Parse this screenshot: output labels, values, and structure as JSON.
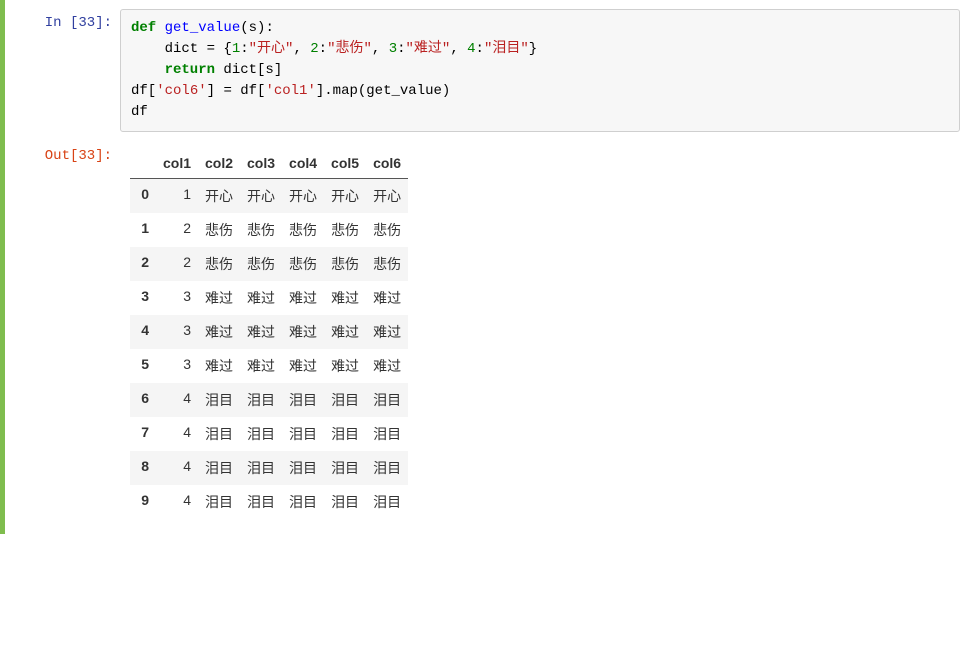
{
  "input": {
    "prompt": "In [33]:",
    "code_line1_def": "def",
    "code_line1_fn": " get_value",
    "code_line1_paren_open": "(",
    "code_line1_arg": "s",
    "code_line1_paren_close": ")",
    "code_line1_colon": ":",
    "code_line2_tail": "}",
    "code": {
      "dict_assign": "    dict = {",
      "k1": "1",
      "c1": ":",
      "v1": "\"开心\"",
      "sep1": ", ",
      "k2": "2",
      "c2": ":",
      "v2": "\"悲伤\"",
      "sep2": ", ",
      "k3": "3",
      "c3": ":",
      "v3": "\"难过\"",
      "sep3": ", ",
      "k4": "4",
      "c4": ":",
      "v4": "\"泪目\""
    },
    "code_line3_return": "    return",
    "code_line3_tail": " dict[s]",
    "code_line4_pre": "df[",
    "code_line4_col6": "'col6'",
    "code_line4_mid": "] = df[",
    "code_line4_col1": "'col1'",
    "code_line4_tail": "].map(get_value)",
    "code_line5": "df"
  },
  "output": {
    "prompt": "Out[33]:"
  },
  "chart_data": {
    "type": "table",
    "columns": [
      "col1",
      "col2",
      "col3",
      "col4",
      "col5",
      "col6"
    ],
    "index": [
      "0",
      "1",
      "2",
      "3",
      "4",
      "5",
      "6",
      "7",
      "8",
      "9"
    ],
    "rows": [
      {
        "idx": "0",
        "col1": "1",
        "col2": "开心",
        "col3": "开心",
        "col4": "开心",
        "col5": "开心",
        "col6": "开心"
      },
      {
        "idx": "1",
        "col1": "2",
        "col2": "悲伤",
        "col3": "悲伤",
        "col4": "悲伤",
        "col5": "悲伤",
        "col6": "悲伤"
      },
      {
        "idx": "2",
        "col1": "2",
        "col2": "悲伤",
        "col3": "悲伤",
        "col4": "悲伤",
        "col5": "悲伤",
        "col6": "悲伤"
      },
      {
        "idx": "3",
        "col1": "3",
        "col2": "难过",
        "col3": "难过",
        "col4": "难过",
        "col5": "难过",
        "col6": "难过"
      },
      {
        "idx": "4",
        "col1": "3",
        "col2": "难过",
        "col3": "难过",
        "col4": "难过",
        "col5": "难过",
        "col6": "难过"
      },
      {
        "idx": "5",
        "col1": "3",
        "col2": "难过",
        "col3": "难过",
        "col4": "难过",
        "col5": "难过",
        "col6": "难过"
      },
      {
        "idx": "6",
        "col1": "4",
        "col2": "泪目",
        "col3": "泪目",
        "col4": "泪目",
        "col5": "泪目",
        "col6": "泪目"
      },
      {
        "idx": "7",
        "col1": "4",
        "col2": "泪目",
        "col3": "泪目",
        "col4": "泪目",
        "col5": "泪目",
        "col6": "泪目"
      },
      {
        "idx": "8",
        "col1": "4",
        "col2": "泪目",
        "col3": "泪目",
        "col4": "泪目",
        "col5": "泪目",
        "col6": "泪目"
      },
      {
        "idx": "9",
        "col1": "4",
        "col2": "泪目",
        "col3": "泪目",
        "col4": "泪目",
        "col5": "泪目",
        "col6": "泪目"
      }
    ]
  }
}
